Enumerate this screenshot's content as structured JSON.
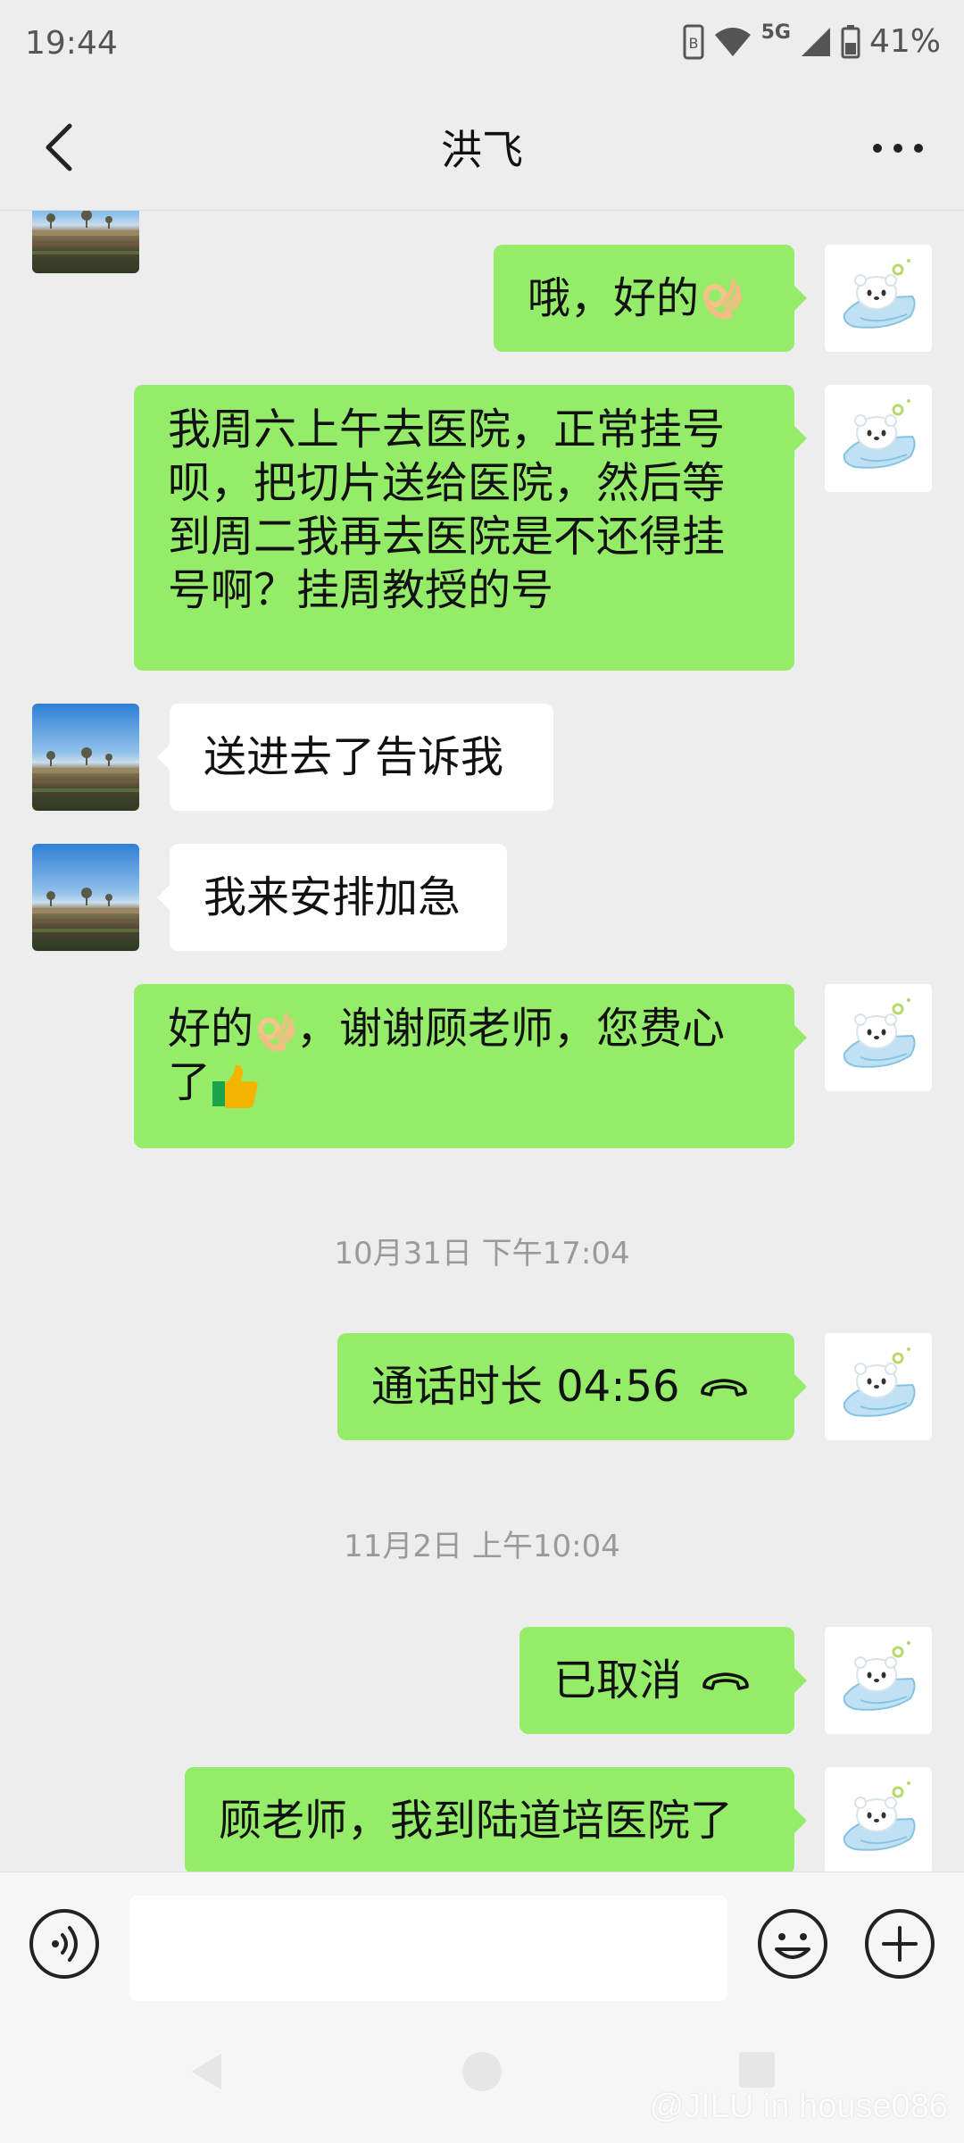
{
  "status_bar": {
    "time": "19:44",
    "network": "5G",
    "battery": "41%",
    "icons": [
      "nfc-icon",
      "wifi-icon",
      "signal-icon",
      "battery-icon"
    ]
  },
  "header": {
    "title": "洪飞",
    "back_icon": "chevron-left-icon",
    "more_icon": "more-dots-icon"
  },
  "colors": {
    "background": "#ededed",
    "my_bubble": "#95ec69",
    "their_bubble": "#ffffff",
    "timestamp_text": "#9a9a9a"
  },
  "messages": [
    {
      "sender": "me",
      "text": "哦，好的",
      "emoji": "ok-hand-emoji"
    },
    {
      "sender": "me",
      "lines": [
        "我周六上午去医院，正常挂号",
        "呗，把切片送给医院，然后等",
        "到周二我再去医院是不还得挂",
        "号啊？挂周教授的号"
      ]
    },
    {
      "sender": "them",
      "text": "送进去了告诉我"
    },
    {
      "sender": "them",
      "text": "我来安排加急"
    },
    {
      "sender": "me",
      "line1": "好的",
      "line1_after": "，谢谢顾老师，您费心",
      "line2": "了",
      "emojis": [
        "ok-hand-emoji",
        "thumbs-up-emoji"
      ]
    },
    {
      "type": "timestamp",
      "text": "10月31日 下午17:04"
    },
    {
      "sender": "me",
      "text": "通话时长 04:56",
      "icon": "phone-hangup-icon"
    },
    {
      "type": "timestamp",
      "text": "11月2日 上午10:04"
    },
    {
      "sender": "me",
      "text": "已取消",
      "icon": "phone-hangup-icon"
    },
    {
      "sender": "me",
      "text": "顾老师，我到陆道培医院了"
    }
  ],
  "input_bar": {
    "value": "",
    "icons": [
      "voice-icon",
      "emoji-icon",
      "plus-icon"
    ]
  },
  "system_nav": {
    "icons": [
      "back-triangle-icon",
      "home-circle-icon",
      "recents-square-icon"
    ]
  },
  "watermark": "@JILU in house086"
}
